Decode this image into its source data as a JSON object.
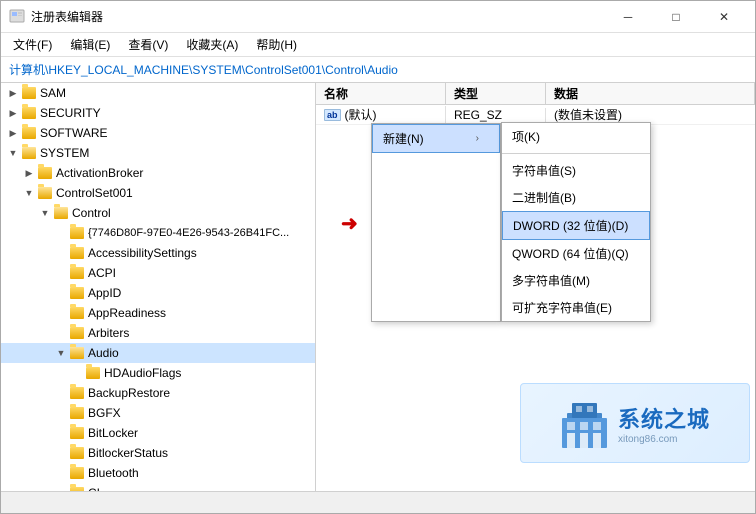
{
  "window": {
    "title": "注册表编辑器",
    "icon": "regedit"
  },
  "menu": {
    "items": [
      "文件(F)",
      "编辑(E)",
      "查看(V)",
      "收藏夹(A)",
      "帮助(H)"
    ]
  },
  "address": {
    "label": "计算机\\HKEY_LOCAL_MACHINE\\SYSTEM\\ControlSet001\\Control\\Audio"
  },
  "tree": {
    "items": [
      {
        "id": "sam",
        "label": "SAM",
        "indent": 1,
        "expanded": false,
        "level": 1
      },
      {
        "id": "security",
        "label": "SECURITY",
        "indent": 1,
        "expanded": false,
        "level": 1
      },
      {
        "id": "software",
        "label": "SOFTWARE",
        "indent": 1,
        "expanded": false,
        "level": 1
      },
      {
        "id": "system",
        "label": "SYSTEM",
        "indent": 1,
        "expanded": true,
        "level": 1
      },
      {
        "id": "activationbroker",
        "label": "ActivationBroker",
        "indent": 2,
        "expanded": false,
        "level": 2
      },
      {
        "id": "controlset001",
        "label": "ControlSet001",
        "indent": 2,
        "expanded": true,
        "level": 2
      },
      {
        "id": "control",
        "label": "Control",
        "indent": 3,
        "expanded": true,
        "level": 3
      },
      {
        "id": "guid",
        "label": "{7746D80F-97E0-4E26-9543-26B41FC...",
        "indent": 4,
        "expanded": false,
        "level": 4
      },
      {
        "id": "accessibilitysettings",
        "label": "AccessibilitySettings",
        "indent": 4,
        "expanded": false,
        "level": 4
      },
      {
        "id": "acpi",
        "label": "ACPI",
        "indent": 4,
        "expanded": false,
        "level": 4
      },
      {
        "id": "appid",
        "label": "AppID",
        "indent": 4,
        "expanded": false,
        "level": 4
      },
      {
        "id": "appreadiness",
        "label": "AppReadiness",
        "indent": 4,
        "expanded": false,
        "level": 4
      },
      {
        "id": "arbiters",
        "label": "Arbiters",
        "indent": 4,
        "expanded": false,
        "level": 4
      },
      {
        "id": "audio",
        "label": "Audio",
        "indent": 4,
        "expanded": true,
        "selected": true,
        "level": 4
      },
      {
        "id": "hdaudioflags",
        "label": "HDAudioFlags",
        "indent": 5,
        "expanded": false,
        "level": 5
      },
      {
        "id": "backuprestore",
        "label": "BackupRestore",
        "indent": 4,
        "expanded": false,
        "level": 4
      },
      {
        "id": "bgfx",
        "label": "BGFX",
        "indent": 4,
        "expanded": false,
        "level": 4
      },
      {
        "id": "bitlocker",
        "label": "BitLocker",
        "indent": 4,
        "expanded": false,
        "level": 4
      },
      {
        "id": "bitlockerstatus",
        "label": "BitlockerStatus",
        "indent": 4,
        "expanded": false,
        "level": 4
      },
      {
        "id": "bluetooth",
        "label": "Bluetooth",
        "indent": 4,
        "expanded": false,
        "level": 4
      },
      {
        "id": "ci",
        "label": "CI",
        "indent": 4,
        "expanded": false,
        "level": 4
      }
    ]
  },
  "registry_data": {
    "headers": {
      "name": "名称",
      "type": "类型",
      "data": "数据"
    },
    "rows": [
      {
        "name": "(默认)",
        "type": "REG_SZ",
        "data": "(数值未设置)",
        "icon": "ab"
      }
    ]
  },
  "context_menu": {
    "main": {
      "items": [
        {
          "label": "新建(N)",
          "has_submenu": true,
          "highlighted": true
        }
      ]
    },
    "submenu": {
      "items": [
        {
          "label": "项(K)",
          "highlighted": false
        },
        {
          "label": "",
          "separator": true
        },
        {
          "label": "字符串值(S)",
          "highlighted": false
        },
        {
          "label": "二进制值(B)",
          "highlighted": false
        },
        {
          "label": "DWORD (32 位值)(D)",
          "highlighted": true
        },
        {
          "label": "QWORD (64 位值)(Q)",
          "highlighted": false
        },
        {
          "label": "多字符串值(M)",
          "highlighted": false
        },
        {
          "label": "可扩充字符串值(E)",
          "highlighted": false
        }
      ]
    }
  },
  "watermark": {
    "text": "系统之城",
    "url": "xitong86.com"
  },
  "titlebar": {
    "minimize": "─",
    "maximize": "□",
    "close": "✕"
  }
}
